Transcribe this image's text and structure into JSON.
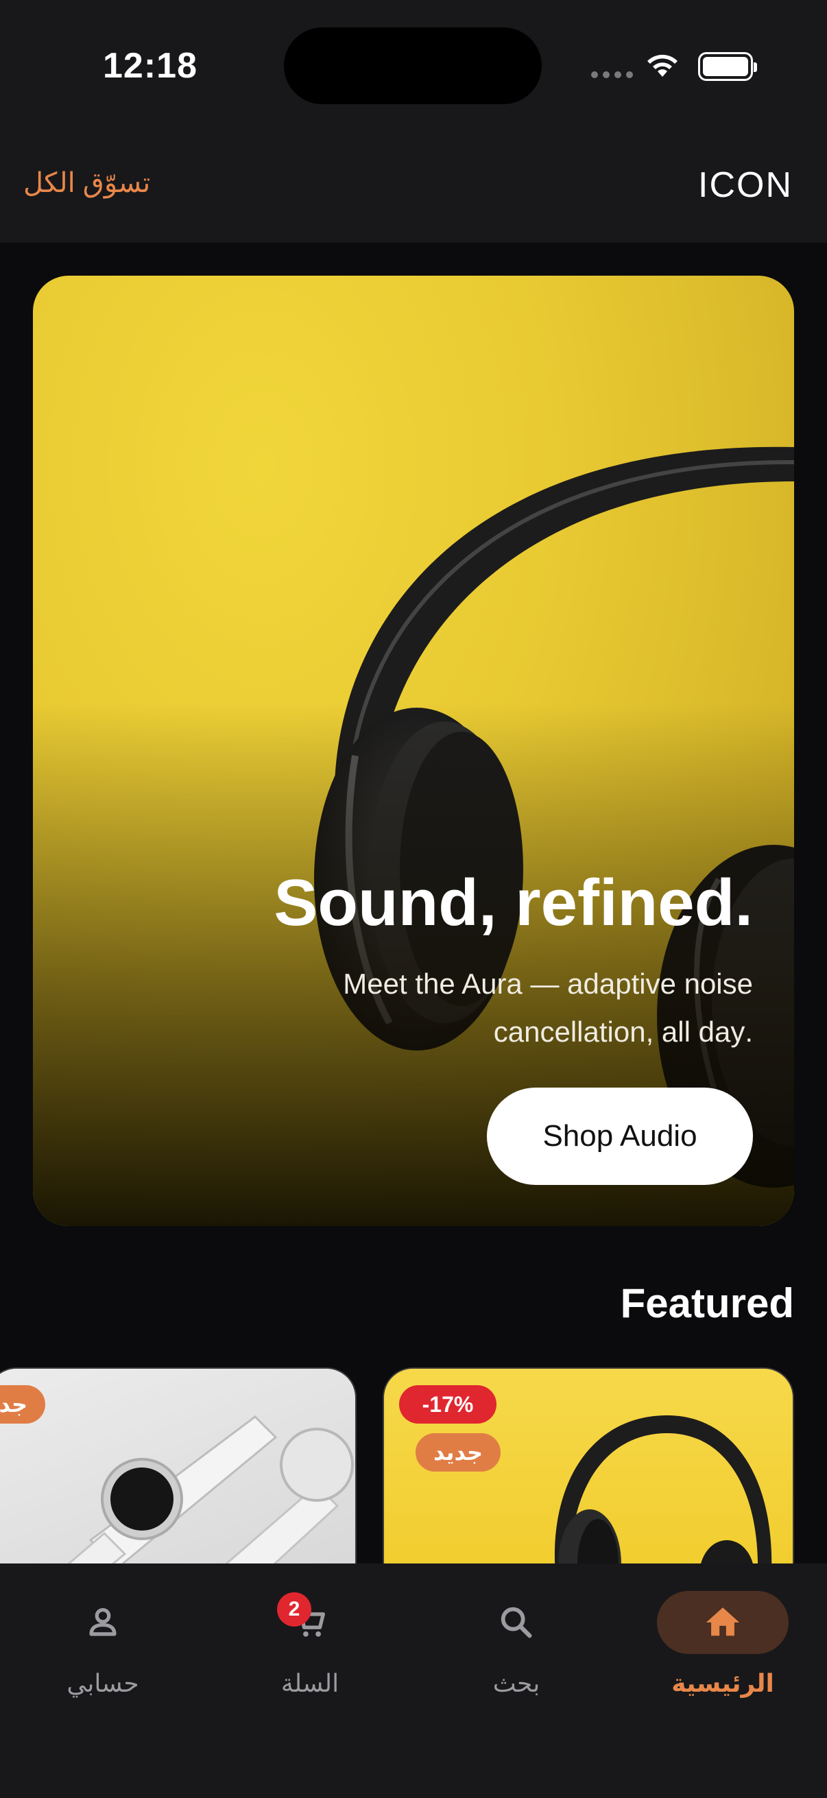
{
  "status_bar": {
    "time": "12:18"
  },
  "header": {
    "brand": "ICON",
    "shop_all": "تسوّق الكل"
  },
  "hero": {
    "title": ".Sound, refined",
    "subtitle": "Meet the Aura — adaptive noise cancellation, all day.",
    "subtitle_line1": "Meet the Aura — adaptive noise",
    "subtitle_line2": ".cancellation, all day",
    "button": "Shop Audio"
  },
  "featured": {
    "title": "Featured",
    "cards": [
      {
        "badges": [
          "-17%",
          "جديد"
        ],
        "image": "headphones-image"
      },
      {
        "badges": [
          "جديد"
        ],
        "image": "smartwatch-image"
      }
    ]
  },
  "tabs": {
    "home": {
      "label": "الرئيسية",
      "icon": "home-icon",
      "active": true
    },
    "search": {
      "label": "بحث",
      "icon": "search-icon"
    },
    "cart": {
      "label": "السلة",
      "icon": "cart-icon",
      "badge": "2"
    },
    "account": {
      "label": "حسابي",
      "icon": "user-icon"
    }
  },
  "colors": {
    "accent": "#e8874a",
    "sale": "#e0262f",
    "background": "#0b0b0d",
    "surface": "#18181a"
  }
}
